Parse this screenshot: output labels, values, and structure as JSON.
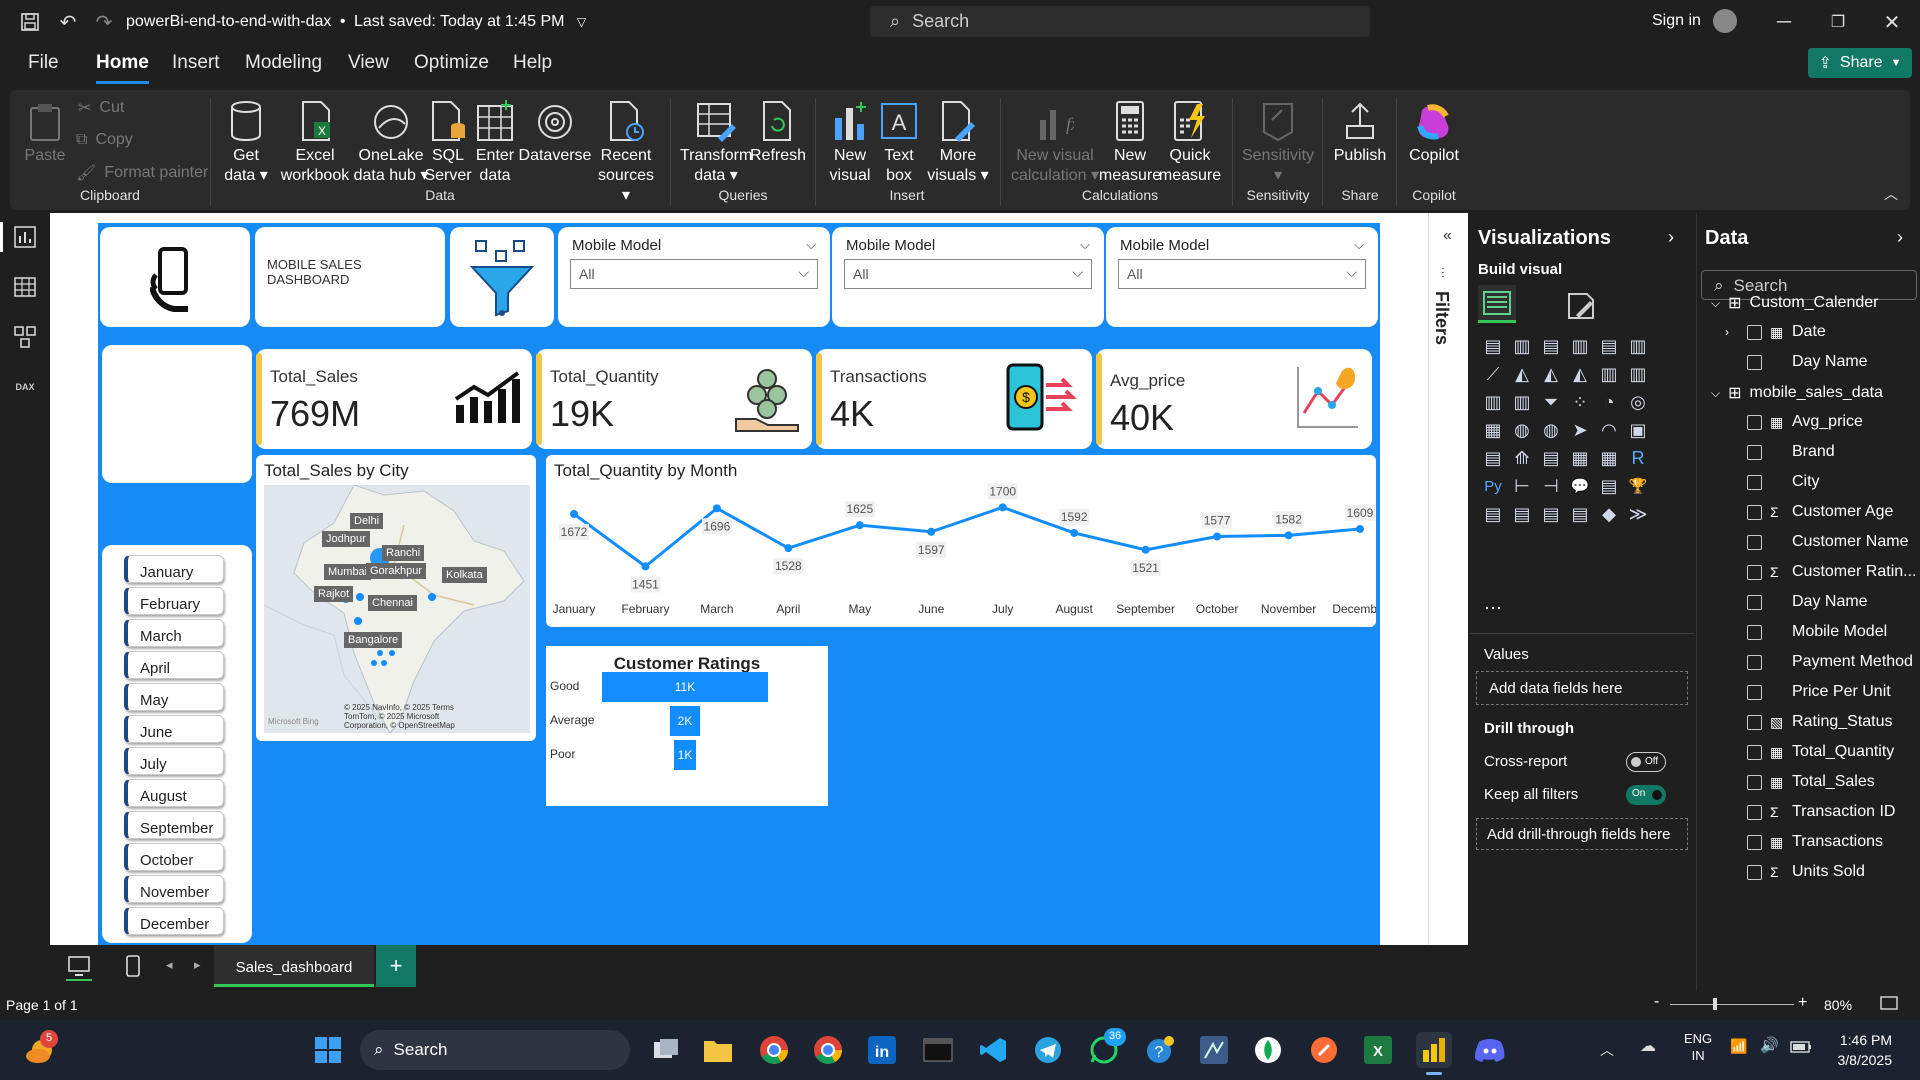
{
  "titlebar": {
    "file_title": "powerBi-end-to-end-with-dax",
    "saved": "Last saved: Today at 1:45 PM",
    "search_placeholder": "Search",
    "sign_in": "Sign in"
  },
  "menu": {
    "items": [
      "File",
      "Home",
      "Insert",
      "Modeling",
      "View",
      "Optimize",
      "Help"
    ],
    "active": "Home",
    "share": "Share"
  },
  "ribbon": {
    "clipboard": {
      "paste": "Paste",
      "cut": "Cut",
      "copy": "Copy",
      "format_painter": "Format painter",
      "group": "Clipboard"
    },
    "data": {
      "get_data": [
        "Get",
        "data"
      ],
      "excel": [
        "Excel",
        "workbook"
      ],
      "onelake": [
        "OneLake",
        "data hub"
      ],
      "sql": [
        "SQL",
        "Server"
      ],
      "enter": [
        "Enter",
        "data"
      ],
      "dataverse": [
        "Dataverse",
        ""
      ],
      "recent": [
        "Recent",
        "sources"
      ],
      "group": "Data"
    },
    "queries": {
      "transform": [
        "Transform",
        "data"
      ],
      "refresh": [
        "Refresh",
        ""
      ],
      "group": "Queries"
    },
    "insert": {
      "new_visual": [
        "New",
        "visual"
      ],
      "text_box": [
        "Text",
        "box"
      ],
      "more_visuals": [
        "More",
        "visuals"
      ],
      "group": "Insert"
    },
    "calculations": {
      "new_visual_calc": [
        "New visual",
        "calculation"
      ],
      "new_measure": [
        "New",
        "measure"
      ],
      "quick_measure": [
        "Quick",
        "measure"
      ],
      "group": "Calculations"
    },
    "sensitivity": {
      "label": "Sensitivity",
      "group": "Sensitivity"
    },
    "share": {
      "publish": "Publish",
      "group": "Share"
    },
    "copilot": {
      "label": "Copilot",
      "group": "Copilot"
    }
  },
  "report": {
    "header_title": "MOBILE SALES DASHBOARD",
    "slicers": [
      {
        "title": "Mobile Model",
        "value": "All"
      },
      {
        "title": "Mobile Model",
        "value": "All"
      },
      {
        "title": "Mobile Model",
        "value": "All"
      }
    ],
    "kpis": [
      {
        "label": "Total_Sales",
        "value": "769M"
      },
      {
        "label": "Total_Quantity",
        "value": "19K"
      },
      {
        "label": "Transactions",
        "value": "4K"
      },
      {
        "label": "Avg_price",
        "value": "40K"
      }
    ],
    "months": [
      "January",
      "February",
      "March",
      "April",
      "May",
      "June",
      "July",
      "August",
      "September",
      "October",
      "November",
      "December"
    ],
    "map": {
      "title": "Total_Sales by City",
      "cities": [
        "Delhi",
        "Jodhpur",
        "Ranchi",
        "Mumbai",
        "Gorakhpur",
        "Kolkata",
        "Rajkot",
        "Chennai",
        "Bangalore"
      ],
      "attribution": [
        "© 2025 NavInfo, © 2025 Terms",
        "TomTom, © 2025 Microsoft",
        "Corporation, © OpenStreetMap"
      ],
      "bing": "Microsoft Bing"
    },
    "ratings": {
      "title": "Customer Ratings"
    }
  },
  "chart_data": [
    {
      "type": "line",
      "title": "Total_Quantity by Month",
      "categories": [
        "January",
        "February",
        "March",
        "April",
        "May",
        "June",
        "July",
        "August",
        "September",
        "October",
        "November",
        "December"
      ],
      "values": [
        1672,
        1451,
        1696,
        1528,
        1625,
        1597,
        1700,
        1592,
        1521,
        1577,
        1582,
        1609
      ],
      "color": "#118dff"
    },
    {
      "type": "bar",
      "title": "Customer Ratings",
      "categories": [
        "Good",
        "Average",
        "Poor"
      ],
      "values": [
        11000,
        2000,
        1000
      ],
      "labels": [
        "11K",
        "2K",
        "1K"
      ],
      "color": "#118dff"
    }
  ],
  "filters": {
    "label": "Filters"
  },
  "visualizations": {
    "title": "Visualizations",
    "build": "Build visual",
    "values": "Values",
    "add_data": "Add data fields here",
    "drill": "Drill through",
    "cross": "Cross-report",
    "cross_state": "Off",
    "keep": "Keep all filters",
    "keep_state": "On",
    "add_drill": "Add drill-through fields here"
  },
  "data_pane": {
    "title": "Data",
    "search_placeholder": "Search",
    "tables": [
      {
        "name": "Custom_Calender",
        "fields": [
          "Date",
          "Day Name"
        ]
      },
      {
        "name": "mobile_sales_data",
        "fields": [
          "Avg_price",
          "Brand",
          "City",
          "Customer Age",
          "Customer Name",
          "Customer Ratin...",
          "Day Name",
          "Mobile Model",
          "Payment Method",
          "Price Per Unit",
          "Rating_Status",
          "Total_Quantity",
          "Total_Sales",
          "Transaction ID",
          "Transactions",
          "Units Sold"
        ]
      }
    ]
  },
  "pages": {
    "current": "Sales_dashboard",
    "status": "Page 1 of 1",
    "zoom": "80%"
  },
  "taskbar": {
    "search": "Search",
    "lang": "ENG",
    "region": "IN",
    "time": "1:46 PM",
    "date": "3/8/2025",
    "badge_weather": "5",
    "badge_whatsapp": "36"
  }
}
